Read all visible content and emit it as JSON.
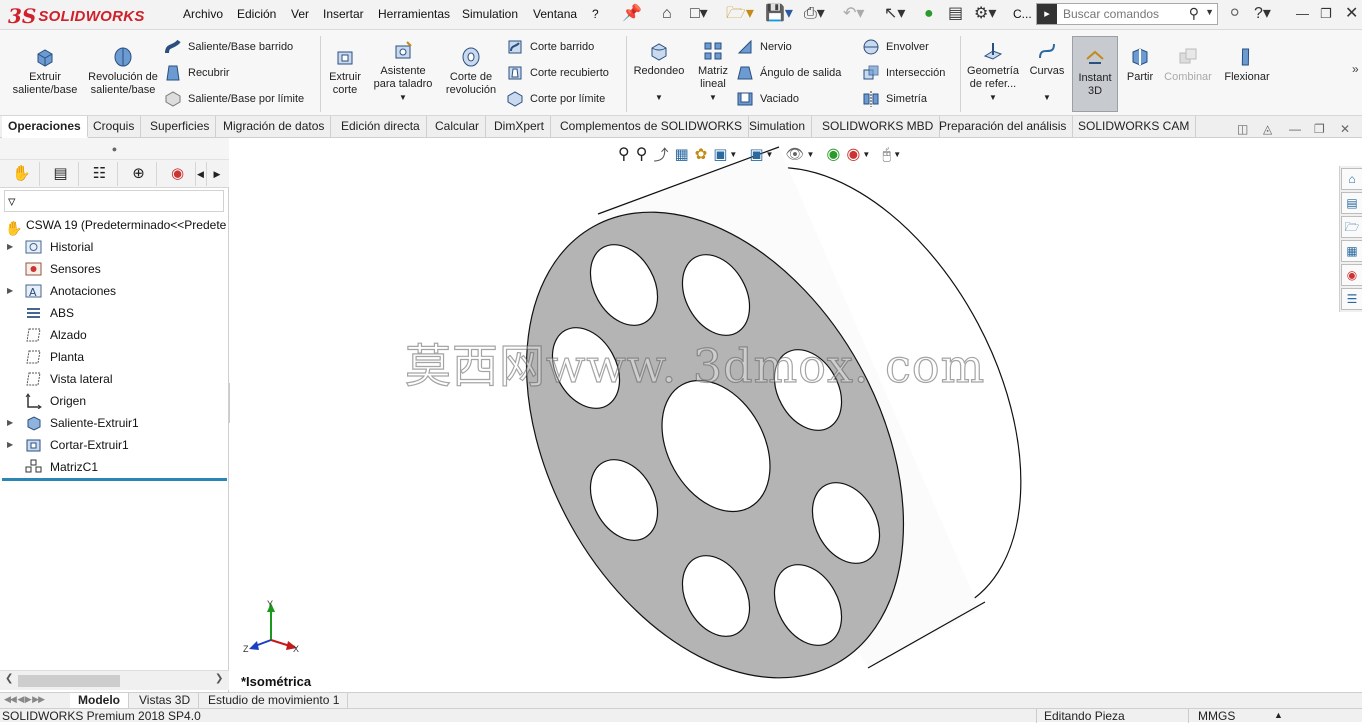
{
  "app": {
    "logo_ds": "3S",
    "logo_text": "SOLIDWORKS"
  },
  "menu": {
    "items": [
      "Archivo",
      "Edición",
      "Ver",
      "Insertar",
      "Herramientas",
      "Simulation",
      "Ventana",
      "?"
    ],
    "truncated": "C...",
    "search_placeholder": "Buscar comandos"
  },
  "ribbon": {
    "extrude": "Extruir saliente/base",
    "revolve": "Revolución de saliente/base",
    "sweep": "Saliente/Base barrido",
    "loft": "Recubrir",
    "boundary": "Saliente/Base por límite",
    "extrude_cut": "Extruir corte",
    "hole_wizard": "Asistente para taladro",
    "revolve_cut": "Corte de revolución",
    "swept_cut": "Corte barrido",
    "lofted_cut": "Corte recubierto",
    "boundary_cut": "Corte por límite",
    "fillet": "Redondeo",
    "linear_pattern": "Matriz lineal",
    "rib": "Nervio",
    "draft": "Ángulo de salida",
    "shell": "Vaciado",
    "wrap": "Envolver",
    "intersect": "Intersección",
    "mirror": "Simetría",
    "ref_geometry": "Geometría de refer...",
    "curves": "Curvas",
    "instant3d": "Instant 3D",
    "split": "Partir",
    "combine": "Combinar",
    "flex": "Flexionar"
  },
  "tabs": [
    "Operaciones",
    "Croquis",
    "Superficies",
    "Migración de datos",
    "Edición directa",
    "Calcular",
    "DimXpert",
    "Complementos de SOLIDWORKS",
    "Simulation",
    "SOLIDWORKS MBD",
    "Preparación del análisis",
    "SOLIDWORKS CAM"
  ],
  "tree": {
    "root": "CSWA 19  (Predeterminado<<Predete",
    "items": [
      "Historial",
      "Sensores",
      "Anotaciones",
      "ABS",
      "Alzado",
      "Planta",
      "Vista lateral",
      "Origen",
      "Saliente-Extruir1",
      "Cortar-Extruir1",
      "MatrizC1"
    ]
  },
  "triad": {
    "x": "X",
    "y": "Y",
    "z": "Z"
  },
  "viewport": {
    "view_label": "*Isométrica",
    "watermark": "莫西网www. 3dmox. com"
  },
  "bottom_tabs": [
    "Modelo",
    "Vistas 3D",
    "Estudio de movimiento 1"
  ],
  "status": {
    "product": "SOLIDWORKS Premium 2018 SP4.0",
    "mode": "Editando Pieza",
    "units": "MMGS"
  },
  "colors": {
    "brand_red": "#d0202a",
    "face_gray": "#b3b3b3",
    "accent_blue": "#2a86b4"
  }
}
